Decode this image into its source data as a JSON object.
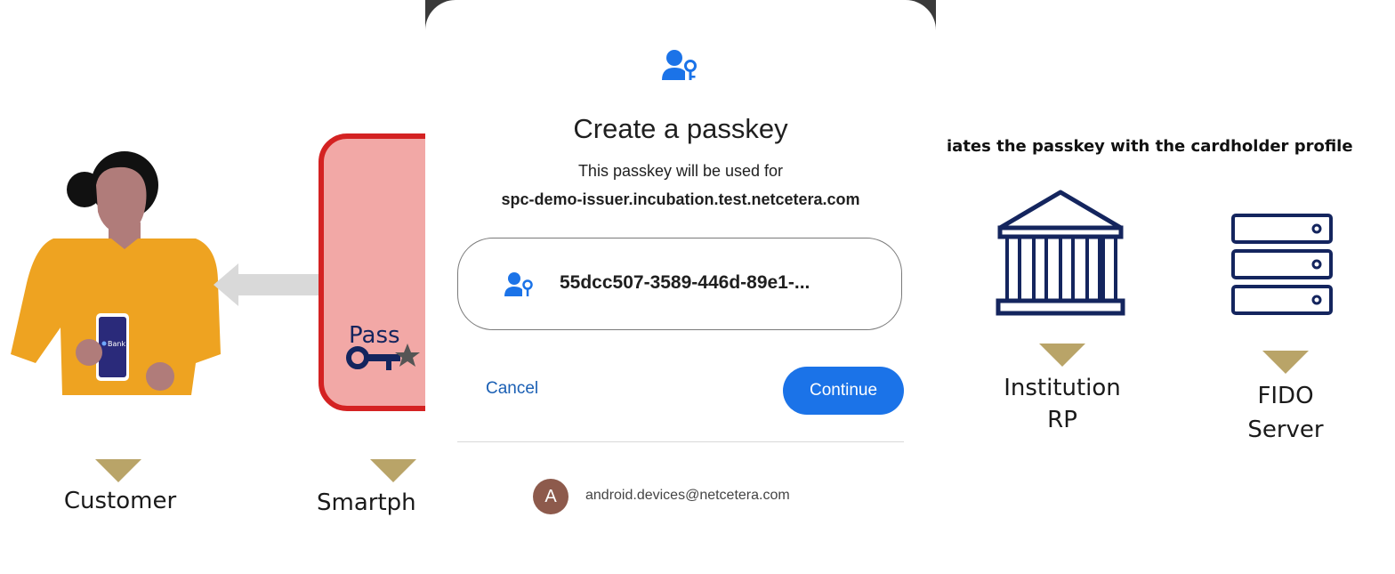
{
  "diagram": {
    "heading": "iates the passkey with the cardholder profile",
    "customer_label": "Customer",
    "smartphone_label": "Smartph",
    "smartphone_box_text": "Pass",
    "phone_bank_text": "Bank",
    "institution_label_line1": "Institution",
    "institution_label_line2": "RP",
    "fido_label_line1": "FIDO",
    "fido_label_line2": "Server",
    "colors": {
      "marker": "#b9a468",
      "navy": "#14255e",
      "box_fill": "#f2a8a6",
      "box_border": "#d42222",
      "shirt": "#eea321",
      "skin": "#b07c7a"
    }
  },
  "dialog": {
    "icon": "passkey-icon",
    "title": "Create a passkey",
    "subtitle": "This passkey will be used for",
    "domain": "spc-demo-issuer.incubation.test.netcetera.com",
    "account_name": "55dcc507-3589-446d-89e1-...",
    "cancel_label": "Cancel",
    "continue_label": "Continue",
    "avatar_letter": "A",
    "email": "android.devices@netcetera.com",
    "colors": {
      "accent": "#1b73e8",
      "avatar": "#8d5a4c"
    }
  }
}
